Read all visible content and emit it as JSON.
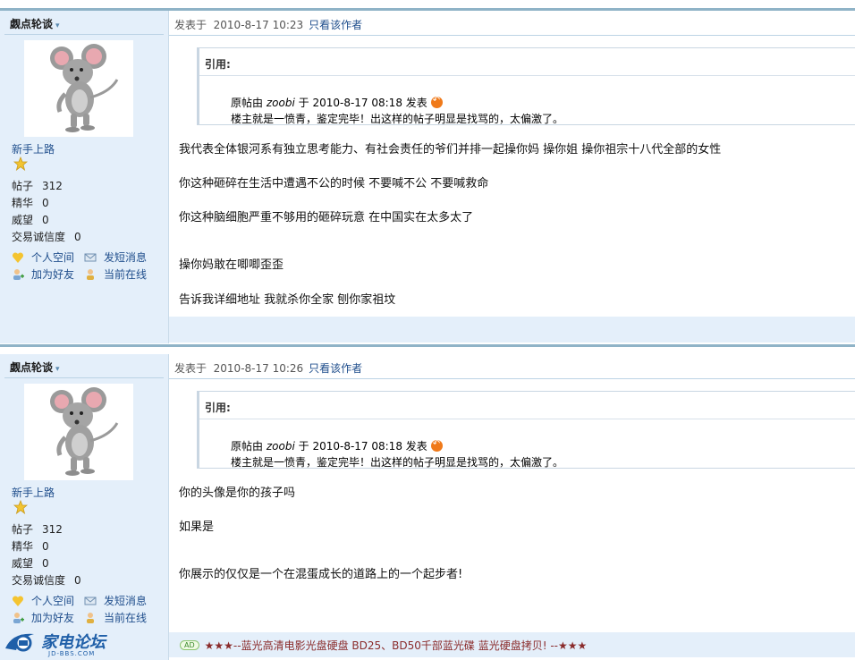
{
  "posts": [
    {
      "author": {
        "name": "觑点轮谈",
        "rank": "新手上路",
        "stats": [
          {
            "label": "帖子",
            "value": "312"
          },
          {
            "label": "精华",
            "value": "0"
          },
          {
            "label": "威望",
            "value": "0"
          },
          {
            "label": "交易诚信度",
            "value": "0"
          }
        ],
        "actions": {
          "space": "个人空间",
          "message": "发短消息",
          "friend": "加为好友",
          "online": "当前在线"
        }
      },
      "meta": {
        "posted_prefix": "发表于",
        "date": "2010-8-17 10:23",
        "only_author": "只看该作者"
      },
      "quote": {
        "title": "引用:",
        "by_prefix": "原帖由",
        "by_user": "zoobi",
        "by_mid": "于",
        "by_date": "2010-8-17 08:18",
        "by_suffix": "发表",
        "text": "楼主就是一愤青，鉴定完毕！出这样的帖子明显是找骂的，太偏激了。"
      },
      "paragraphs": [
        "我代表全体银河系有独立思考能力、有社会责任的爷们并排一起操你妈    操你姐    操你祖宗十八代全部的女性",
        "你这种砸碎在生活中遭遇不公的时候      不要喊不公    不要喊救命",
        "你这种脑细胞严重不够用的砸碎玩意    在中国实在太多太了",
        "操你妈敢在唧唧歪歪",
        "告诉我详细地址    我就杀你全家    刨你家祖坟"
      ]
    },
    {
      "author": {
        "name": "觑点轮谈",
        "rank": "新手上路",
        "stats": [
          {
            "label": "帖子",
            "value": "312"
          },
          {
            "label": "精华",
            "value": "0"
          },
          {
            "label": "威望",
            "value": "0"
          },
          {
            "label": "交易诚信度",
            "value": "0"
          }
        ],
        "actions": {
          "space": "个人空间",
          "message": "发短消息",
          "friend": "加为好友",
          "online": "当前在线"
        }
      },
      "meta": {
        "posted_prefix": "发表于",
        "date": "2010-8-17 10:26",
        "only_author": "只看该作者"
      },
      "quote": {
        "title": "引用:",
        "by_prefix": "原帖由",
        "by_user": "zoobi",
        "by_mid": "于",
        "by_date": "2010-8-17 08:18",
        "by_suffix": "发表",
        "text": "楼主就是一愤青，鉴定完毕！出这样的帖子明显是找骂的，太偏激了。"
      },
      "paragraphs": [
        "你的头像是你的孩子吗",
        "如果是",
        "你展示的仅仅是一个在混蛋成长的道路上的一个起步者!"
      ]
    }
  ],
  "ad": {
    "badge": "AD",
    "text": "★★★--蓝光高清电影光盘硬盘  BD25、BD50千部蓝光碟  蓝光硬盘拷贝!   --★★★"
  },
  "logo": {
    "text": "家电论坛",
    "sub": "JD-BBS.COM"
  },
  "colors": {
    "sidebar": "#e4effa",
    "link": "#1f4e8c",
    "divider": "#8fb3c7",
    "ad_text": "#8a2b2b"
  }
}
